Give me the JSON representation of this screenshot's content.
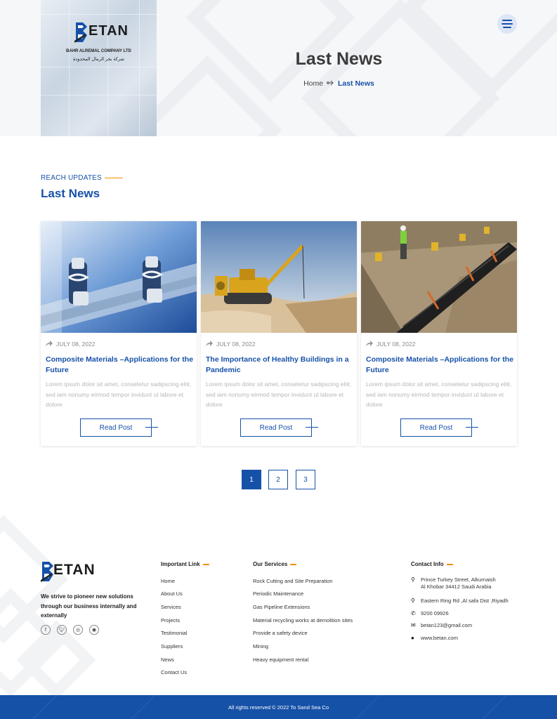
{
  "brand": {
    "logo_text": "ETAN",
    "company_en": "BAHR ALREMAL COMPANY LTD",
    "company_ar": "شركة بحر الرمال المحدودة",
    "primary_color": "#1651a8",
    "accent_color": "#f39200"
  },
  "hero": {
    "title": "Last News",
    "breadcrumb": {
      "home": "Home",
      "current": "Last News"
    }
  },
  "section": {
    "eyebrow": "REACH UPDATES",
    "title": "Last News"
  },
  "cards": [
    {
      "date": "JULY 08, 2022",
      "title": "Composite Materials –Applications for the Future",
      "text": "Lorem ipsum dolor sit amet, consetetur sadipscing elitr, sed iam nonumy eirmod tempor invidunt ut labore et dolore",
      "button": "Read Post"
    },
    {
      "date": "JULY 08, 2022",
      "title": "The Importance of Healthy Buildings in a Pandemic",
      "text": "Lorem ipsum dolor sit amet, consetetur sadipscing elitr, sed iam nonumy eirmod tempor invidunt ut labore et dolore",
      "button": "Read Post"
    },
    {
      "date": "JULY 08, 2022",
      "title": "Composite Materials –Applications for the Future",
      "text": "Lorem ipsum dolor sit amet, consetetur sadipscing elitr, sed iam nonumy eirmod tempor invidunt ut labore et dolore",
      "button": "Read Post"
    }
  ],
  "pagination": [
    "1",
    "2",
    "3"
  ],
  "footer": {
    "logo_text": "ETAN",
    "about": "We strive to pioneer new solutions through our business internally and externally",
    "social_icons": [
      "facebook-icon",
      "twitter-icon",
      "instagram-icon",
      "snapchat-icon"
    ],
    "important_links": {
      "title": "Important Link",
      "items": [
        "Home",
        "About Us",
        "Services",
        "Projects",
        "Testimonial",
        "Suppliers",
        "News",
        "Contact Us"
      ]
    },
    "services": {
      "title": "Our Services",
      "items": [
        "Rock Cutting and Site Preparation",
        "Periodic Maintenance",
        "Gas Pipeline Extensions",
        "Material recycling works at demolition sites",
        "Provide a safety device",
        "Mining",
        "Heavy equipment rental"
      ]
    },
    "contact": {
      "title": "Contact Info",
      "address1_line1": "Prince Turkey Street, Alkurnaish",
      "address1_line2": "Al Khobar 34412  Saudi Arabia",
      "address2": "Eastern Ring Rd ,Al safa Dist ,Riyadh",
      "phone": "9200 09926",
      "email": "betan123@gmail.com",
      "website": "www.betan.com"
    },
    "copyright": "All rights reserved © 2022 To Sand Sea Co"
  }
}
